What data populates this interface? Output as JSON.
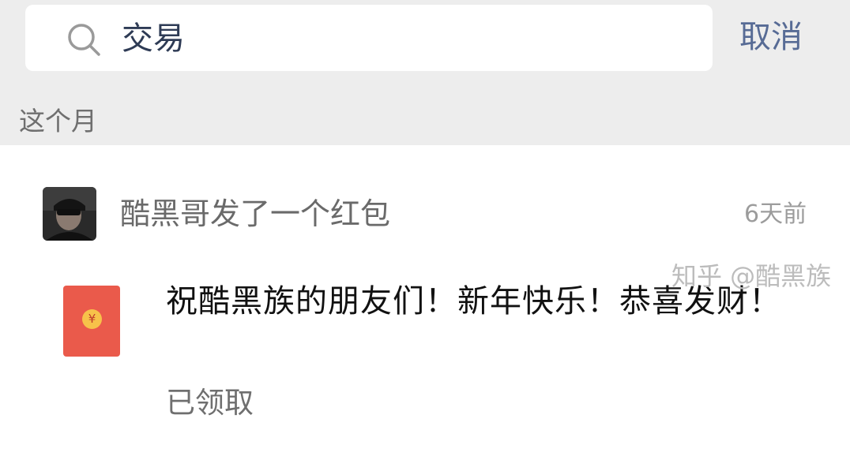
{
  "search": {
    "query": "交易",
    "cancel_label": "取消"
  },
  "section": {
    "header": "这个月"
  },
  "result": {
    "sender_line": "酷黑哥发了一个红包",
    "time": "6天前",
    "message": "祝酷黑族的朋友们！新年快乐！恭喜发财！",
    "status": "已领取",
    "redpacket_symbol": "¥"
  },
  "watermark": "知乎 @酷黑族",
  "colors": {
    "link": "#576b95",
    "redpacket": "#ea5a4b",
    "coin": "#f7c24a"
  }
}
